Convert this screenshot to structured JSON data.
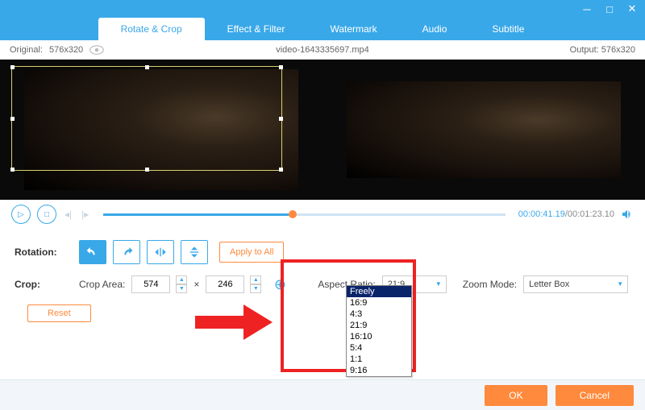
{
  "window": {
    "minimize": "─",
    "maximize": "□",
    "close": "✕"
  },
  "tabs": {
    "rotate_crop": "Rotate & Crop",
    "effect_filter": "Effect & Filter",
    "watermark": "Watermark",
    "audio": "Audio",
    "subtitle": "Subtitle"
  },
  "info": {
    "original_label": "Original:",
    "original_value": "576x320",
    "filename": "video-1643335697.mp4",
    "output_label": "Output:",
    "output_value": "576x320"
  },
  "playback": {
    "current": "00:00:41.19",
    "total": "/00:01:23.10"
  },
  "rotation": {
    "label": "Rotation:",
    "apply_all": "Apply to All"
  },
  "crop": {
    "label": "Crop:",
    "area_label": "Crop Area:",
    "width": "574",
    "times": "×",
    "height": "246",
    "aspect_label": "Aspect Ratio:",
    "aspect_value": "21:9",
    "zoom_label": "Zoom Mode:",
    "zoom_value": "Letter Box",
    "reset": "Reset"
  },
  "aspect_options": [
    "Freely",
    "16:9",
    "4:3",
    "21:9",
    "16:10",
    "5:4",
    "1:1",
    "9:16"
  ],
  "footer": {
    "ok": "OK",
    "cancel": "Cancel"
  }
}
